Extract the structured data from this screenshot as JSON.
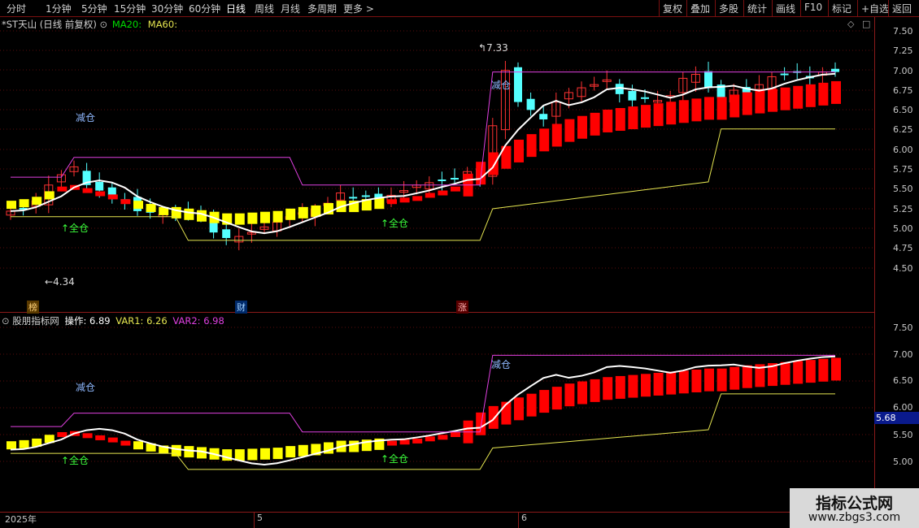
{
  "toolbar": {
    "periods": [
      "分时",
      "1分钟",
      "5分钟",
      "15分钟",
      "30分钟",
      "60分钟",
      "日线",
      "周线",
      "月线",
      "多周期",
      "更多 >"
    ],
    "right": [
      "复权",
      "叠加",
      "多股",
      "统计",
      "画线",
      "F10",
      "标记",
      "+自选",
      "返回"
    ]
  },
  "main": {
    "stock": "*ST天山 (日线 前复权)",
    "ma20": "MA20:",
    "ma60": "MA60:",
    "high_note": "7.33",
    "low_note": "4.34",
    "y_ticks": [
      "7.50",
      "7.25",
      "7.00",
      "6.75",
      "6.50",
      "6.25",
      "6.00",
      "5.75",
      "5.50",
      "5.25",
      "5.00",
      "4.75",
      "4.50"
    ],
    "reduce_label": "减仓",
    "full_label": "↑全仓",
    "flags": [
      "榜",
      "财",
      "涨"
    ]
  },
  "indicator": {
    "name": "股朋指标网",
    "op_label": "操作: 6.89",
    "var1_label": "VAR1: 6.26",
    "var2_label": "VAR2: 6.98",
    "y_ticks": [
      "7.50",
      "7.00",
      "6.50",
      "6.00",
      "5.50",
      "5.00"
    ],
    "highlight": "5.68",
    "reduce_label": "减仓",
    "full_label": "↑全仓"
  },
  "dates": [
    "2025年",
    "5",
    "6"
  ],
  "watermark": {
    "line1": "指标公式网",
    "line2": "www.zbgs3.com"
  },
  "colors": {
    "up": "#ff3232",
    "down": "#54ffff",
    "ma": "#ffffff",
    "var2": "#e040e0",
    "var1": "#e6e650",
    "yellow": "#ffff00",
    "red": "#ff0000"
  }
}
